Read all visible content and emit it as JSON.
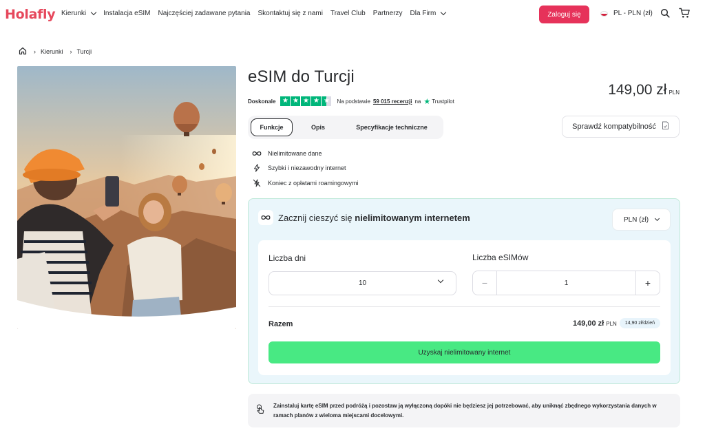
{
  "header": {
    "logo": "Holafly",
    "nav": [
      {
        "label": "Kierunki",
        "dropdown": true
      },
      {
        "label": "Instalacja eSIM",
        "dropdown": false
      },
      {
        "label": "Najczęściej zadawane pytania",
        "dropdown": false
      },
      {
        "label": "Skontaktuj się z nami",
        "dropdown": false
      },
      {
        "label": "Travel Club",
        "dropdown": false
      },
      {
        "label": "Partnerzy",
        "dropdown": false
      },
      {
        "label": "Dla Firm",
        "dropdown": true
      }
    ],
    "login_label": "Zaloguj się",
    "lang_label": "PL - PLN (zł)",
    "search_icon": "search-icon",
    "cart_icon": "cart-icon",
    "brand_color": "#e6325a"
  },
  "breadcrumb": {
    "home_icon": "home-icon",
    "items": [
      "Kierunki",
      "Turcji"
    ]
  },
  "product": {
    "title": "eSIM do Turcji",
    "rating_word": "Doskonale",
    "stars": 4.5,
    "reviews_prefix": "Na podstawie",
    "reviews_count": "59 015 recenzji",
    "reviews_suffix": "na",
    "trustpilot": "Trustpilot",
    "price": "149,00 zł",
    "price_currency": "PLN"
  },
  "tabs": [
    "Funkcje",
    "Opis",
    "Specyfikacje techniczne"
  ],
  "compat_label": "Sprawdź kompatybilność",
  "features": [
    {
      "icon": "infinity-icon",
      "label": "Nielimitowane dane"
    },
    {
      "icon": "lightning-icon",
      "label": "Szybki i niezawodny internet"
    },
    {
      "icon": "no-roaming-icon",
      "label": "Koniec z opłatami roamingowymi"
    }
  ],
  "card": {
    "title_prefix": "Zacznij cieszyć się ",
    "title_bold": "nielimitowanym internetem",
    "currency_select": "PLN (zł)",
    "days_label": "Liczba dni",
    "days_value": "10",
    "esims_label": "Liczba eSIMów",
    "esims_value": "1",
    "minus": "−",
    "plus": "+",
    "total_label": "Razem",
    "total_price": "149,00 zł",
    "total_currency": "PLN",
    "per_day": "14,90 zł/dzień",
    "cta": "Uzyskaj nielimitowany internet",
    "cta_color": "#48e983"
  },
  "note": "Zainstaluj kartę eSIM przed podróżą i pozostaw ją wyłączoną dopóki nie będziesz jej potrzebować, aby uniknąć zbędnego wykorzystania danych w ramach planów z wieloma miejscami docelowymi."
}
